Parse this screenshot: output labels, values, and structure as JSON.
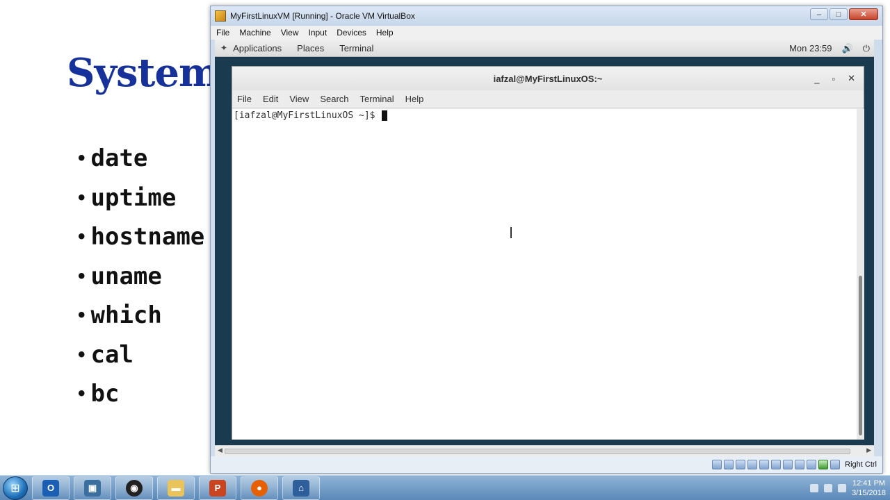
{
  "slide": {
    "title": "System",
    "bullets": [
      "date",
      "uptime",
      "hostname",
      "uname",
      "which",
      "cal",
      "bc"
    ]
  },
  "vbox": {
    "title": "MyFirstLinuxVM [Running] - Oracle VM VirtualBox",
    "menu": [
      "File",
      "Machine",
      "View",
      "Input",
      "Devices",
      "Help"
    ],
    "host_key": "Right Ctrl"
  },
  "gnome": {
    "items": [
      "Applications",
      "Places",
      "Terminal"
    ],
    "clock": "Mon 23:59"
  },
  "terminal": {
    "title": "iafzal@MyFirstLinuxOS:~",
    "menu": [
      "File",
      "Edit",
      "View",
      "Search",
      "Terminal",
      "Help"
    ],
    "prompt": "[iafzal@MyFirstLinuxOS ~]$ "
  },
  "taskbar": {
    "time": "12:41 PM",
    "date": "3/15/2018"
  }
}
